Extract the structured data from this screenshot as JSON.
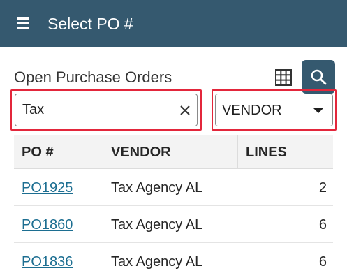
{
  "header": {
    "menu_icon": "hamburger-icon",
    "title": "Select PO #"
  },
  "section": {
    "title": "Open Purchase Orders",
    "grid_icon": "grid-icon",
    "search_icon": "search-icon"
  },
  "colors": {
    "header_bg": "#35596f",
    "link": "#1c6e91",
    "highlight": "#e3263b"
  },
  "filter": {
    "search_value": "Tax",
    "clear_icon": "close-icon",
    "field_selected": "VENDOR",
    "caret_icon": "caret-down-icon"
  },
  "table": {
    "columns": [
      "PO #",
      "VENDOR",
      "LINES"
    ],
    "rows": [
      {
        "po": "PO1925",
        "vendor": "Tax Agency AL",
        "lines": "2"
      },
      {
        "po": "PO1860",
        "vendor": "Tax Agency AL",
        "lines": "6"
      },
      {
        "po": "PO1836",
        "vendor": "Tax Agency AL",
        "lines": "6"
      }
    ]
  }
}
